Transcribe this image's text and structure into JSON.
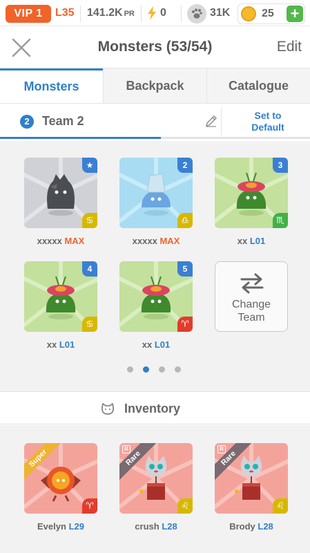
{
  "status": {
    "vip": "VIP 1",
    "level": "L35",
    "power": "141.2K",
    "power_unit": "PR",
    "energy": "0",
    "paws": "31K",
    "coins": "25",
    "plus": "+"
  },
  "header": {
    "title": "Monsters (53/54)",
    "edit": "Edit"
  },
  "tabs": [
    {
      "label": "Monsters",
      "active": true
    },
    {
      "label": "Backpack",
      "active": false
    },
    {
      "label": "Catalogue",
      "active": false
    }
  ],
  "team": {
    "number": "2",
    "name": "Team 2",
    "set_default_line1": "Set to",
    "set_default_line2": "Default",
    "slots": [
      {
        "badge": "★",
        "name": "xxxxx",
        "level": "MAX",
        "zodiac": "♋",
        "color": "#cfcfcf"
      },
      {
        "badge": "2",
        "name": "xxxxx",
        "level": "MAX",
        "zodiac": "♎",
        "color": "#bfe3f5"
      },
      {
        "badge": "3",
        "name": "xx",
        "level": "L01",
        "zodiac": "♏",
        "color": "#cfe7b0"
      },
      {
        "badge": "4",
        "name": "xx",
        "level": "L01",
        "zodiac": "♋",
        "color": "#cfe7b0"
      },
      {
        "badge": "5",
        "name": "xx",
        "level": "L01",
        "zodiac": "♈",
        "color": "#cfe7b0"
      }
    ],
    "change_line1": "Change",
    "change_line2": "Team",
    "page_count": 4,
    "current_page": 2
  },
  "inventory": {
    "title": "Inventory",
    "items": [
      {
        "ribbon": "Super",
        "name": "Evelyn",
        "level": "L29",
        "zodiac": "♈"
      },
      {
        "ribbon": "Rare",
        "tag": "R",
        "name": "crush",
        "level": "L28",
        "zodiac": "♌"
      },
      {
        "ribbon": "Rare",
        "tag": "R",
        "name": "Brody",
        "level": "L28",
        "zodiac": "♌"
      }
    ]
  },
  "colors": {
    "accent": "#2f80c9",
    "vip": "#f0632a",
    "plus": "#52b84c",
    "inventory_card": "#f5a7a0"
  }
}
